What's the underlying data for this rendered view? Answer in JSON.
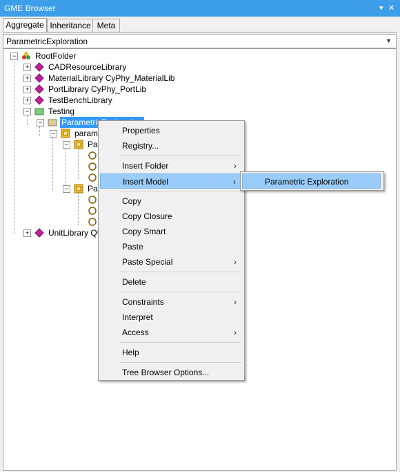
{
  "window": {
    "title": "GME Browser"
  },
  "titlebar_icons": {
    "dropdown": "▾",
    "pin": "📌",
    "close": "✕"
  },
  "tabs": [
    {
      "label": "Aggregate",
      "active": true
    },
    {
      "label": "Inheritance",
      "active": false
    },
    {
      "label": "Meta",
      "active": false
    }
  ],
  "project_selector": {
    "value": "ParametricExploration"
  },
  "tree": {
    "root": "RootFolder",
    "items": [
      "CADResourceLibrary",
      "MaterialLibrary CyPhy_MaterialLib",
      "PortLibrary CyPhy_PortLib",
      "TestBenchLibrary",
      "Testing",
      "ParametricExploration",
      "parame",
      "Par",
      "Par",
      "UnitLibrary QUI"
    ]
  },
  "context_menu": {
    "items": [
      {
        "label": "Properties"
      },
      {
        "label": "Registry..."
      },
      {
        "label": "Insert Folder",
        "submenu": true
      },
      {
        "label": "Insert Model",
        "submenu": true,
        "highlighted": true
      },
      {
        "label": "Copy"
      },
      {
        "label": "Copy Closure"
      },
      {
        "label": "Copy Smart"
      },
      {
        "label": "Paste"
      },
      {
        "label": "Paste Special",
        "submenu": true
      },
      {
        "label": "Delete"
      },
      {
        "label": "Constraints",
        "submenu": true
      },
      {
        "label": "Interpret"
      },
      {
        "label": "Access",
        "submenu": true
      },
      {
        "label": "Help"
      },
      {
        "label": "Tree Browser Options..."
      }
    ],
    "submenu_arrow": "›"
  },
  "submenu": {
    "items": [
      {
        "label": "Parametric Exploration",
        "highlighted": true
      }
    ]
  },
  "colors": {
    "titlebar": "#3d9ee9",
    "selection": "#3399ff",
    "menu_highlight": "#99ccf8"
  }
}
